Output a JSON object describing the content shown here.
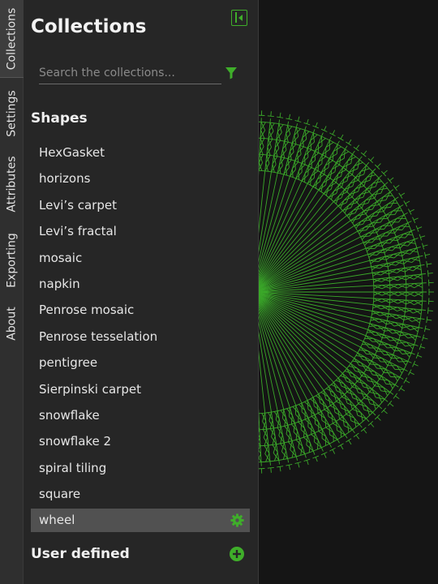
{
  "tabs": [
    "Collections",
    "Settings",
    "Attributes",
    "Exporting",
    "About"
  ],
  "panel": {
    "title": "Collections",
    "search_placeholder": "Search the collections...",
    "section_shapes": "Shapes",
    "section_user": "User defined"
  },
  "shapes": [
    "HexGasket",
    "horizons",
    "Levi’s carpet",
    "Levi’s fractal",
    "mosaic",
    "napkin",
    "Penrose mosaic",
    "Penrose tesselation",
    "pentigree",
    "Sierpinski carpet",
    "snowflake",
    "snowflake 2",
    "spiral tiling",
    "square",
    "wheel"
  ],
  "selected_shape": "wheel",
  "colors": {
    "accent": "#3fae2a",
    "drawing": "#3db02b",
    "panel": "#262626",
    "selection": "#515151"
  },
  "icons": {
    "panel_toggle": "collapse-panel-icon",
    "filter": "filter-icon",
    "settings": "gear-icon",
    "add": "add-circle-icon"
  }
}
